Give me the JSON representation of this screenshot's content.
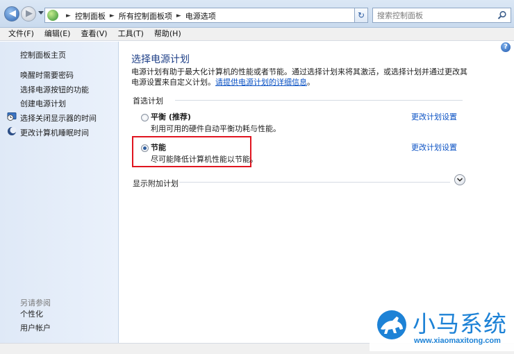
{
  "address_bar": {
    "breadcrumbs": [
      "控制面板",
      "所有控制面板项",
      "电源选项"
    ],
    "search_placeholder": "搜索控制面板"
  },
  "menu": [
    "文件(F)",
    "编辑(E)",
    "查看(V)",
    "工具(T)",
    "帮助(H)"
  ],
  "left_panel": {
    "home": "控制面板主页",
    "links": [
      "唤醒时需要密码",
      "选择电源按钮的功能",
      "创建电源计划",
      "选择关闭显示器的时间",
      "更改计算机睡眠时间"
    ],
    "see_also_title": "另请参阅",
    "see_also_links": [
      "个性化",
      "用户帐户"
    ]
  },
  "main": {
    "title": "选择电源计划",
    "description": "电源计划有助于最大化计算机的性能或者节能。通过选择计划来将其激活，或选择计划并通过更改其电源设置来自定义计划。",
    "description_link": "请提供电源计划的详细信息",
    "description_end": "。",
    "section_title": "首选计划",
    "plans": [
      {
        "name": "平衡 (推荐)",
        "desc": "利用可用的硬件自动平衡功耗与性能。",
        "link": "更改计划设置",
        "selected": false
      },
      {
        "name": "节能",
        "desc": "尽可能降低计算机性能以节能。",
        "link": "更改计划设置",
        "selected": true
      }
    ],
    "show_more": "显示附加计划"
  },
  "watermark": {
    "brand": "小马系统",
    "url": "www.xiaomaxitong.com"
  },
  "colors": {
    "link": "#0b52c4",
    "title": "#1e3f87",
    "highlight": "#e0141f",
    "watermark": "#1d82d6"
  }
}
